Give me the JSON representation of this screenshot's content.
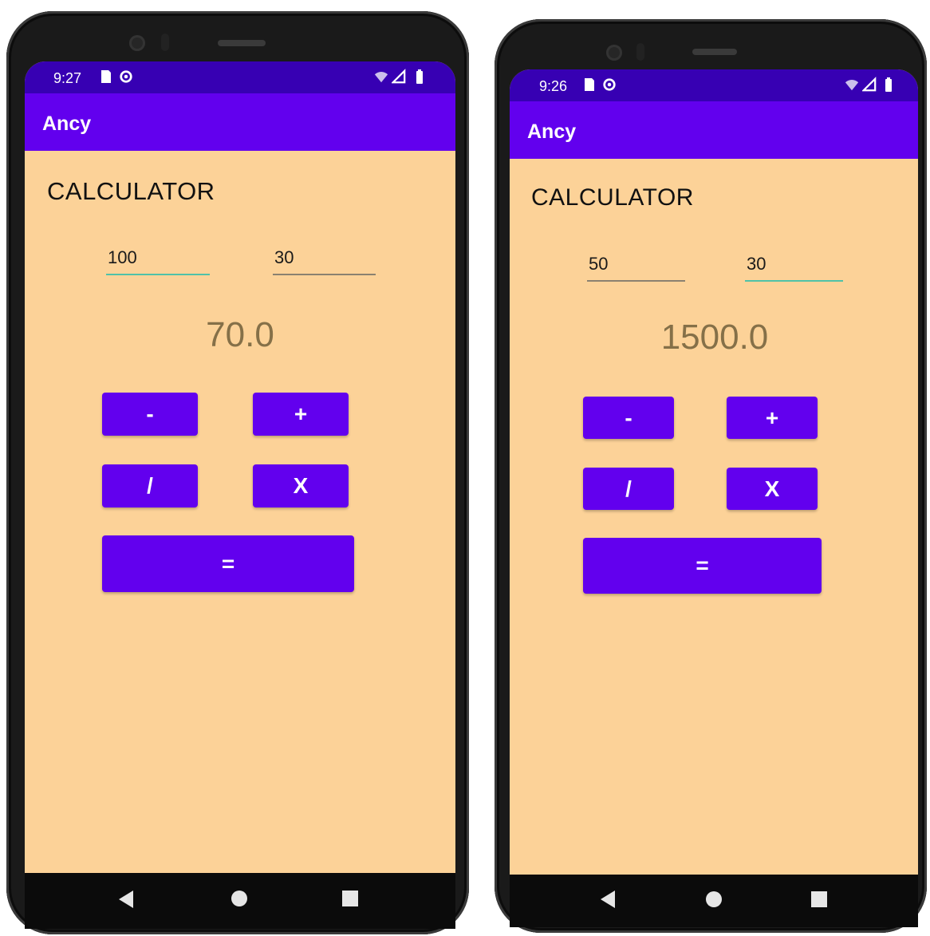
{
  "left": {
    "status": {
      "time": "9:27"
    },
    "app_bar": {
      "title": "Ancy"
    },
    "heading": "CALCULATOR",
    "inputs": {
      "first": "100",
      "second": "30"
    },
    "result": "70.0",
    "buttons": {
      "minus": "-",
      "plus": "+",
      "divide": "/",
      "multiply": "X",
      "equals": "="
    }
  },
  "right": {
    "status": {
      "time": "9:26"
    },
    "app_bar": {
      "title": "Ancy"
    },
    "heading": "CALCULATOR",
    "inputs": {
      "first": "50",
      "second": "30"
    },
    "result": "1500.0",
    "buttons": {
      "minus": "-",
      "plus": "+",
      "divide": "/",
      "multiply": "X",
      "equals": "="
    }
  },
  "colors": {
    "status_bar": "#3700b3",
    "app_bar": "#6200ee",
    "screen_background": "#fcd298",
    "button": "#6200ee",
    "result_text": "#857048",
    "focused_underline": "#4fc2a8"
  },
  "icons": {
    "status": [
      "sim-card-icon",
      "data-saver-icon",
      "wifi-icon",
      "signal-icon",
      "battery-icon"
    ],
    "nav": [
      "back-icon",
      "home-icon",
      "recents-icon"
    ]
  }
}
